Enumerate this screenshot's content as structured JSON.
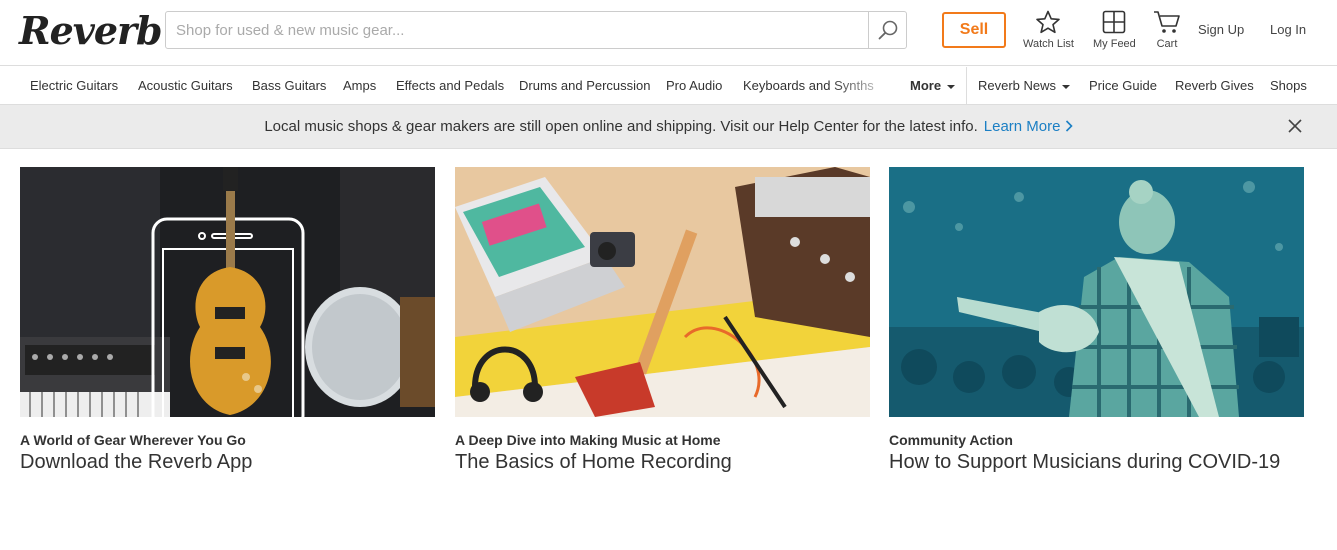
{
  "header": {
    "logo": "Reverb",
    "search_placeholder": "Shop for used & new music gear...",
    "sell_label": "Sell",
    "watch_list_label": "Watch List",
    "my_feed_label": "My Feed",
    "cart_label": "Cart",
    "sign_up_label": "Sign Up",
    "log_in_label": "Log In"
  },
  "categories": [
    "Electric Guitars",
    "Acoustic Guitars",
    "Bass Guitars",
    "Amps",
    "Effects and Pedals",
    "Drums and Percussion",
    "Pro Audio",
    "Keyboards and Synths"
  ],
  "nav_right": {
    "more": "More",
    "reverb_news": "Reverb News",
    "price_guide": "Price Guide",
    "reverb_gives": "Reverb Gives",
    "shops": "Shops"
  },
  "banner": {
    "message": "Local music shops & gear makers are still open online and shipping. Visit our Help Center for the latest info.",
    "link": "Learn More"
  },
  "cards": [
    {
      "kicker": "A World of Gear Wherever You Go",
      "title": "Download the Reverb App"
    },
    {
      "kicker": "A Deep Dive into Making Music at Home",
      "title": "The Basics of Home Recording"
    },
    {
      "kicker": "Community Action",
      "title": "How to Support Musicians during COVID-19"
    }
  ],
  "colors": {
    "accent_orange": "#f27a1a",
    "link_blue": "#1b7fc4",
    "banner_bg": "#ebebeb"
  }
}
